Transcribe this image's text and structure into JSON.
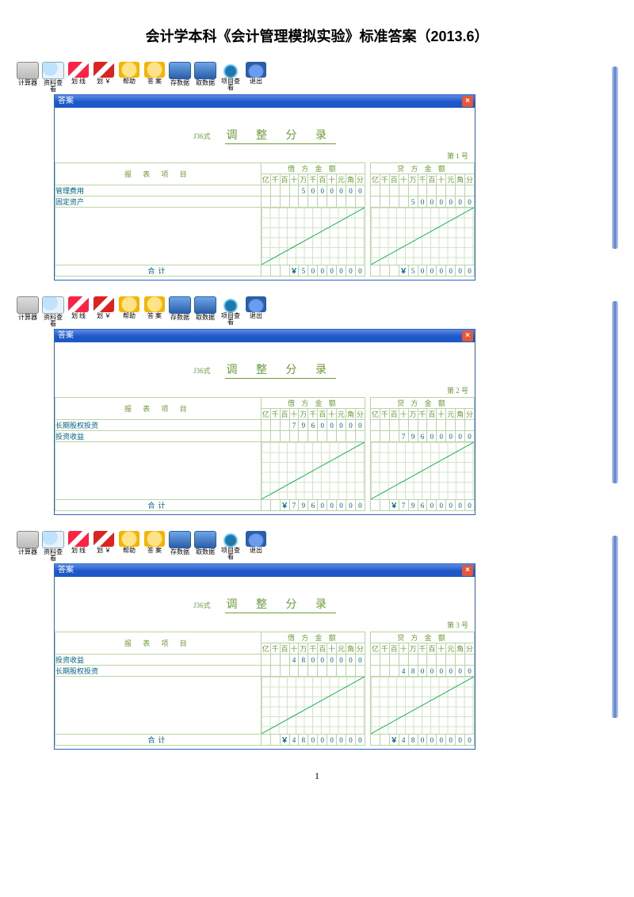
{
  "doc_title": "会计学本科《会计管理模拟实验》标准答案（2013.6）",
  "page_no": "1",
  "toolbar": [
    {
      "name": "calc",
      "label": "计算器"
    },
    {
      "name": "search",
      "label": "资料查看"
    },
    {
      "name": "pen1",
      "label": "划 线"
    },
    {
      "name": "pen2",
      "label": "划 ￥"
    },
    {
      "name": "help",
      "label": "帮助"
    },
    {
      "name": "ans",
      "label": "答 案"
    },
    {
      "name": "save",
      "label": "存数据"
    },
    {
      "name": "load",
      "label": "取数据"
    },
    {
      "name": "view",
      "label": "项目查看"
    },
    {
      "name": "exit",
      "label": "退出"
    }
  ],
  "win_title": "答案",
  "form": {
    "code": "J36式",
    "title": "调 整 分 录",
    "col_item": "报 表 项 目",
    "col_debit": "借 方 金 额",
    "col_credit": "贷 方 金 额",
    "digit_header": [
      "亿",
      "千",
      "百",
      "十",
      "万",
      "千",
      "百",
      "十",
      "元",
      "角",
      "分"
    ],
    "total_label": "合计",
    "currency": "￥"
  },
  "entries": [
    {
      "no": "第 1 号",
      "rows": [
        {
          "item": "管理费用",
          "debit": "5000000",
          "credit": ""
        },
        {
          "item": "固定资产",
          "debit": "",
          "credit": "5000000"
        }
      ],
      "total": {
        "debit": "5000000",
        "credit": "5000000"
      }
    },
    {
      "no": "第 2 号",
      "rows": [
        {
          "item": "长期股权投资",
          "debit": "79600000",
          "credit": ""
        },
        {
          "item": "投资收益",
          "debit": "",
          "credit": "79600000"
        }
      ],
      "total": {
        "debit": "79600000",
        "credit": "79600000"
      }
    },
    {
      "no": "第 3 号",
      "rows": [
        {
          "item": "投资收益",
          "debit": "48000000",
          "credit": ""
        },
        {
          "item": "长期股权投资",
          "debit": "",
          "credit": "48000000"
        }
      ],
      "total": {
        "debit": "48000000",
        "credit": "48000000"
      }
    }
  ]
}
